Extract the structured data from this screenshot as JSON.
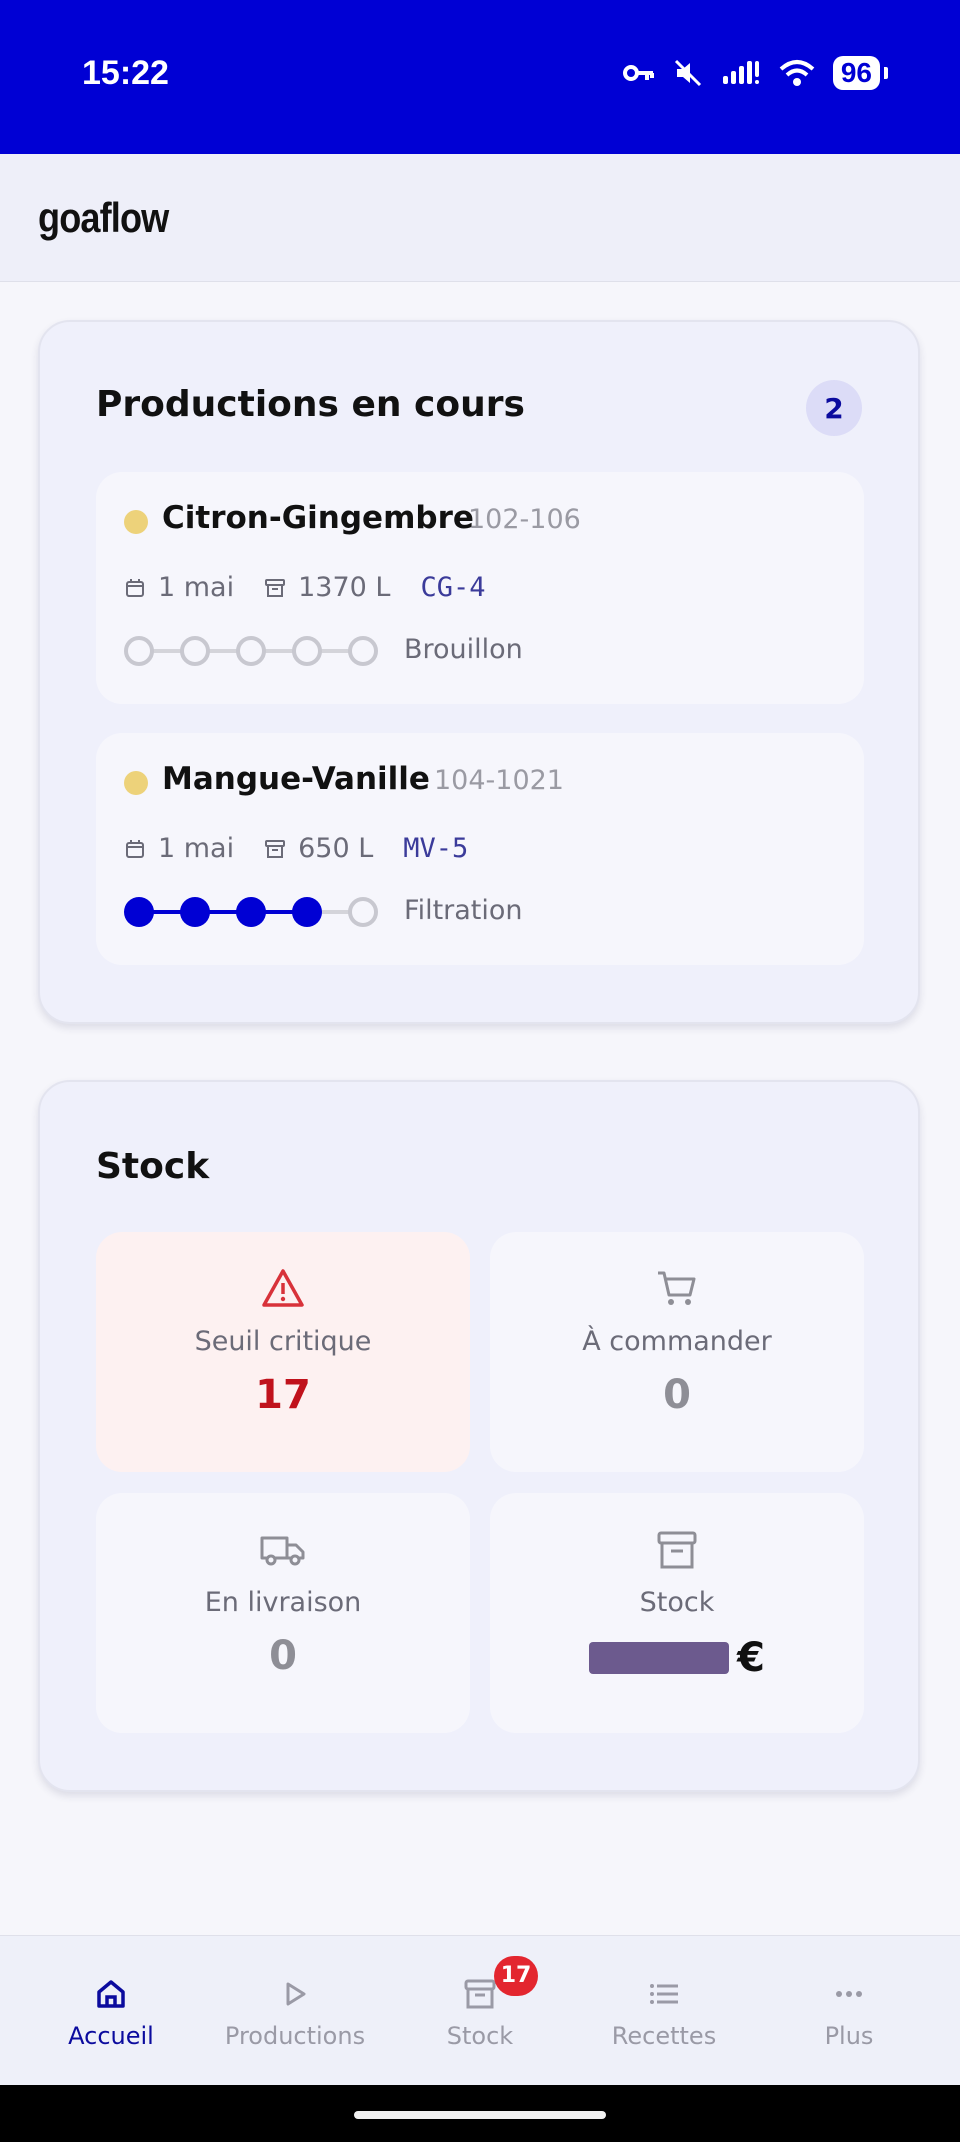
{
  "status_bar": {
    "time": "15:22",
    "battery": "96",
    "icons": [
      "vpn-key-icon",
      "muted-icon",
      "signal-icon",
      "wifi-icon",
      "battery-icon"
    ]
  },
  "app": {
    "brand": "goaflow"
  },
  "productions": {
    "title": "Productions en cours",
    "count": "2",
    "items": [
      {
        "name": "Citron-Gingembre",
        "ref": "102-106",
        "date": "1 mai",
        "volume": "1370 L",
        "code": "CG-4",
        "status": "Brouillon",
        "steps_total": 5,
        "steps_done": 0,
        "dot_color": "#edd27a"
      },
      {
        "name": "Mangue-Vanille",
        "ref": "104-1021",
        "date": "1 mai",
        "volume": "650 L",
        "code": "MV-5",
        "status": "Filtration",
        "steps_total": 5,
        "steps_done": 4,
        "dot_color": "#edd27a"
      }
    ]
  },
  "stock": {
    "title": "Stock",
    "tiles": [
      {
        "label": "Seuil critique",
        "value": "17",
        "icon": "warning-icon"
      },
      {
        "label": "À commander",
        "value": "0",
        "icon": "cart-icon"
      },
      {
        "label": "En livraison",
        "value": "0",
        "icon": "truck-icon"
      },
      {
        "label": "Stock",
        "value_currency": "€",
        "icon": "archive-icon"
      }
    ]
  },
  "nav": {
    "items": [
      {
        "label": "Accueil",
        "icon": "home-icon",
        "active": true
      },
      {
        "label": "Productions",
        "icon": "play-icon"
      },
      {
        "label": "Stock",
        "icon": "archive-icon",
        "badge": "17"
      },
      {
        "label": "Recettes",
        "icon": "list-icon"
      },
      {
        "label": "Plus",
        "icon": "more-icon"
      }
    ]
  },
  "colors": {
    "primary": "#0000d4",
    "critical": "#c0121c",
    "badge": "#e3262f"
  }
}
